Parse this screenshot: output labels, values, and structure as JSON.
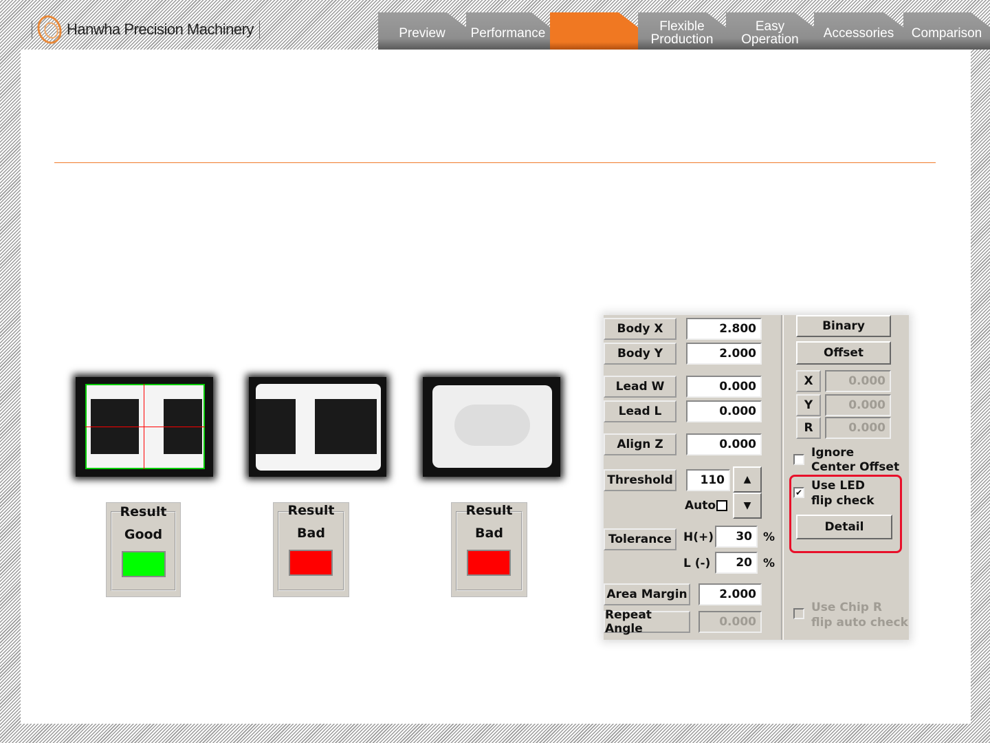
{
  "header": {
    "brand": "Hanwha Precision Machinery",
    "tabs": [
      {
        "label": "Preview"
      },
      {
        "label": "Performance"
      },
      {
        "label": ""
      },
      {
        "label": "Flexible Production"
      },
      {
        "label": "Easy Operation"
      },
      {
        "label": "Accessories"
      },
      {
        "label": "Comparison"
      }
    ],
    "accent": "#f07822"
  },
  "results": [
    {
      "title": "Result",
      "status": "Good",
      "color": "#00ff00"
    },
    {
      "title": "Result",
      "status": "Bad",
      "color": "#ff0000"
    },
    {
      "title": "Result",
      "status": "Bad",
      "color": "#ff0000"
    }
  ],
  "panel": {
    "body_x": {
      "label": "Body X",
      "value": "2.800"
    },
    "body_y": {
      "label": "Body Y",
      "value": "2.000"
    },
    "lead_w": {
      "label": "Lead W",
      "value": "0.000"
    },
    "lead_l": {
      "label": "Lead L",
      "value": "0.000"
    },
    "align_z": {
      "label": "Align Z",
      "value": "0.000"
    },
    "threshold": {
      "label": "Threshold",
      "value": "110",
      "auto_label": "Auto"
    },
    "tolerance": {
      "label": "Tolerance",
      "h_label": "H(+)",
      "h_value": "30",
      "l_label": "L (-)",
      "l_value": "20",
      "unit": "%"
    },
    "area_margin": {
      "label": "Area Margin",
      "value": "2.000"
    },
    "repeat_angle": {
      "label": "Repeat Angle",
      "value": "0.000"
    },
    "binary_label": "Binary",
    "offset_label": "Offset",
    "offset": {
      "x_label": "X",
      "x": "0.000",
      "y_label": "Y",
      "y": "0.000",
      "r_label": "R",
      "r": "0.000"
    },
    "ignore_center": {
      "line1": "Ignore",
      "line2": "Center Offset",
      "checked": false
    },
    "led_flip": {
      "line1": "Use LED",
      "line2": "flip check",
      "checked": true
    },
    "detail_label": "Detail",
    "chip_r": {
      "line1": "Use Chip R",
      "line2": "flip auto check",
      "checked": false
    }
  }
}
